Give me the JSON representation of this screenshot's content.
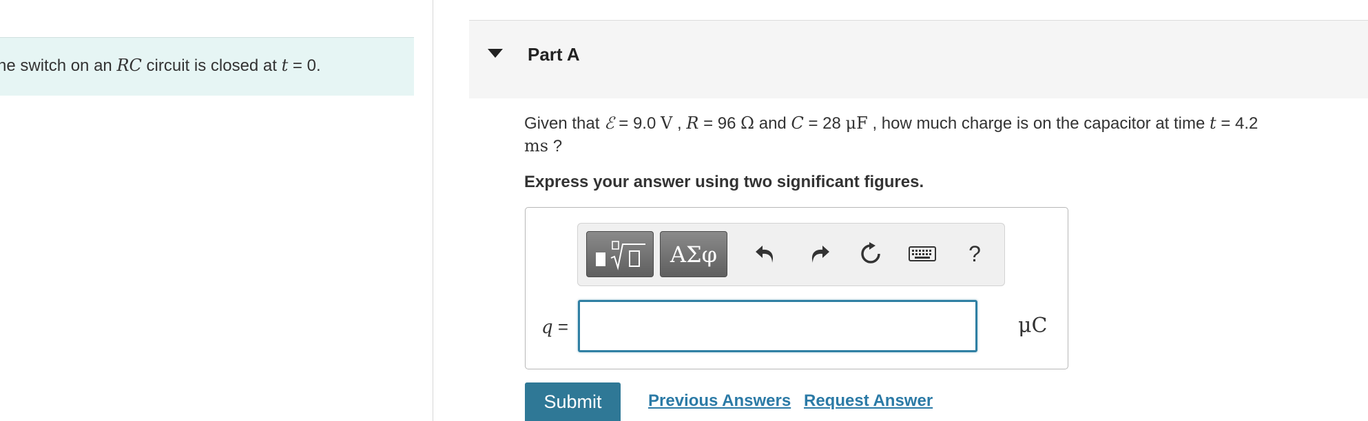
{
  "intro": {
    "prefix": "he switch on an ",
    "rc": "RC",
    "mid": " circuit is closed at ",
    "t": "t",
    "suffix": " = 0."
  },
  "part": {
    "title": "Part A"
  },
  "question": {
    "given_that": "Given that ",
    "emf_symbol": "ℰ",
    "emf_eq": " = 9.0 ",
    "emf_unit": "V",
    "sep1": " , ",
    "r_symbol": "R",
    "r_eq": " = 96 ",
    "r_unit": "Ω",
    "and": " and ",
    "c_symbol": "C",
    "c_eq": " = 28 ",
    "c_unit": "μF",
    "ask": " , how much charge is on the capacitor at time ",
    "t_symbol": "t",
    "t_eq": " = 4.2",
    "t_unit": "ms",
    "q_mark": " ?"
  },
  "instruction": "Express your answer using two significant figures.",
  "toolbar": {
    "templates_icon": "templates-radical-icon",
    "symbols_label": "ΑΣφ",
    "undo_icon": "undo-icon",
    "redo_icon": "redo-icon",
    "reset_icon": "reset-icon",
    "keyboard_icon": "keyboard-icon",
    "help_label": "?"
  },
  "answer": {
    "variable": "q",
    "equals": " =",
    "value": "",
    "unit": "μC"
  },
  "actions": {
    "submit": "Submit",
    "previous_answers": "Previous Answers",
    "request_answer": "Request Answer"
  },
  "colors": {
    "intro_bg": "#e6f5f4",
    "header_bg": "#f5f5f5",
    "submit_bg": "#2f7896",
    "link": "#2b7aa6",
    "input_border": "#2f7fa3"
  }
}
